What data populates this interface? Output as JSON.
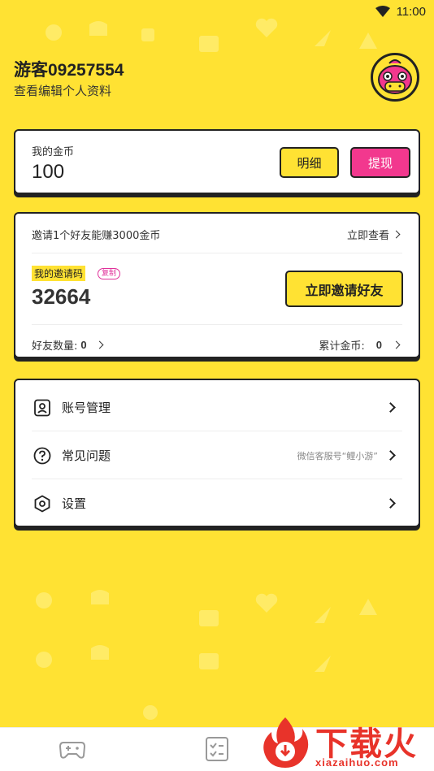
{
  "status_bar": {
    "time": "11:00"
  },
  "profile": {
    "name": "游客09257554",
    "edit_link": "查看编辑个人资料"
  },
  "coins": {
    "label": "我的金币",
    "value": "100",
    "detail_button": "明细",
    "withdraw_button": "提现"
  },
  "invite": {
    "headline": "邀请1个好友能赚3000金币",
    "view_now": "立即查看",
    "code_label": "我的邀请码",
    "copy_label": "复制",
    "code": "32664",
    "invite_button": "立即邀请好友",
    "friends_label": "好友数量:",
    "friends_count": "0",
    "total_label": "累计金币:",
    "total_value": "0"
  },
  "menu": {
    "items": [
      {
        "label": "账号管理",
        "extra": "",
        "icon": "account-card-icon"
      },
      {
        "label": "常见问题",
        "extra": "微信客服号“鲤小游”",
        "icon": "question-icon"
      },
      {
        "label": "设置",
        "extra": "",
        "icon": "settings-hex-icon"
      }
    ]
  },
  "bottom_nav": {
    "items": [
      {
        "icon": "gamepad-icon"
      },
      {
        "icon": "task-list-icon"
      }
    ]
  },
  "watermark": {
    "text": "下载火",
    "sub": "xiazaihuo.com"
  },
  "colors": {
    "background": "#FFE233",
    "accent_pink": "#F2388E",
    "watermark_red": "#E8332A"
  }
}
